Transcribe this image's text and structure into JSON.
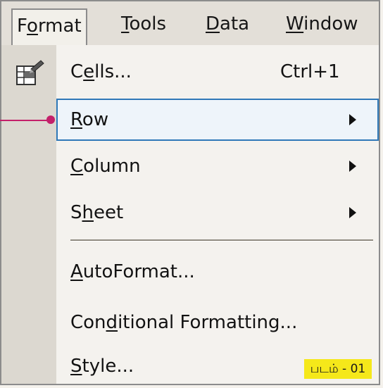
{
  "menubar": {
    "items": [
      {
        "pre": "F",
        "u": "o",
        "post": "rmat",
        "active": true
      },
      {
        "pre": "",
        "u": "T",
        "post": "ools",
        "active": false
      },
      {
        "pre": "",
        "u": "D",
        "post": "ata",
        "active": false
      },
      {
        "pre": "",
        "u": "W",
        "post": "indow",
        "active": false
      }
    ]
  },
  "menu": {
    "cells": {
      "pre": "C",
      "u": "e",
      "post": "lls...",
      "shortcut": "Ctrl+1",
      "icon": "format-cells-icon"
    },
    "row": {
      "pre": "",
      "u": "R",
      "post": "ow",
      "submenu": true
    },
    "column": {
      "pre": "",
      "u": "C",
      "post": "olumn",
      "submenu": true
    },
    "sheet": {
      "pre": "S",
      "u": "h",
      "post": "eet",
      "submenu": true
    },
    "autoformat": {
      "pre": "",
      "u": "A",
      "post": "utoFormat..."
    },
    "conditional": {
      "pre": "Con",
      "u": "d",
      "post": "itional Formatting..."
    },
    "style": {
      "pre": "",
      "u": "S",
      "post": "tyle..."
    }
  },
  "caption": {
    "text": "படம் - 01"
  },
  "colors": {
    "selection_outline": "#2f78b8",
    "pointer": "#c4206a",
    "caption_bg": "#f5e81a"
  }
}
